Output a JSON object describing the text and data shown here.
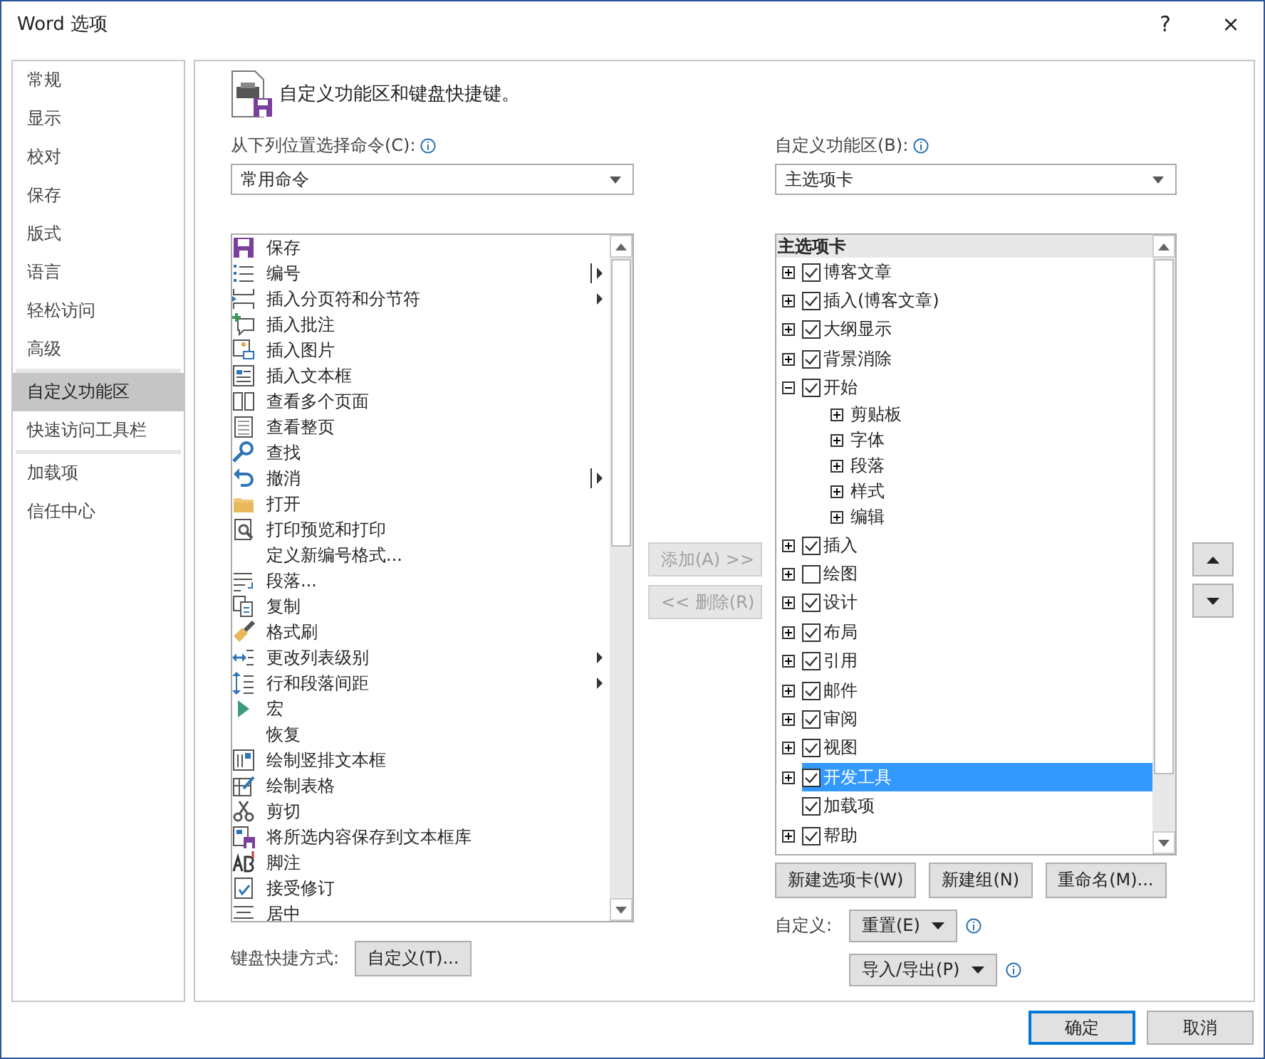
{
  "window": {
    "title": "Word 选项",
    "help": "?",
    "close": "×"
  },
  "sidebar": {
    "sections": [
      [
        {
          "label": "常规",
          "selected": false
        },
        {
          "label": "显示",
          "selected": false
        },
        {
          "label": "校对",
          "selected": false
        },
        {
          "label": "保存",
          "selected": false
        },
        {
          "label": "版式",
          "selected": false
        },
        {
          "label": "语言",
          "selected": false
        },
        {
          "label": "轻松访问",
          "selected": false
        },
        {
          "label": "高级",
          "selected": false
        }
      ],
      [
        {
          "label": "自定义功能区",
          "selected": true
        },
        {
          "label": "快速访问工具栏",
          "selected": false
        }
      ],
      [
        {
          "label": "加载项",
          "selected": false
        },
        {
          "label": "信任中心",
          "selected": false
        }
      ]
    ]
  },
  "header": {
    "title": "自定义功能区和键盘快捷键。"
  },
  "commands": {
    "label": "从下列位置选择命令(C):",
    "select": "常用命令",
    "items": [
      {
        "label": "保存",
        "has_submenu": false,
        "split": false
      },
      {
        "label": "编号",
        "has_submenu": true,
        "split": true
      },
      {
        "label": "插入分页符和分节符",
        "has_submenu": true,
        "split": false
      },
      {
        "label": "插入批注",
        "has_submenu": false,
        "split": false
      },
      {
        "label": "插入图片",
        "has_submenu": false,
        "split": false
      },
      {
        "label": "插入文本框",
        "has_submenu": false,
        "split": false
      },
      {
        "label": "查看多个页面",
        "has_submenu": false,
        "split": false
      },
      {
        "label": "查看整页",
        "has_submenu": false,
        "split": false
      },
      {
        "label": "查找",
        "has_submenu": false,
        "split": false
      },
      {
        "label": "撤消",
        "has_submenu": true,
        "split": true
      },
      {
        "label": "打开",
        "has_submenu": false,
        "split": false
      },
      {
        "label": "打印预览和打印",
        "has_submenu": false,
        "split": false
      },
      {
        "label": "定义新编号格式...",
        "has_submenu": false,
        "split": false
      },
      {
        "label": "段落...",
        "has_submenu": false,
        "split": false
      },
      {
        "label": "复制",
        "has_submenu": false,
        "split": false
      },
      {
        "label": "格式刷",
        "has_submenu": false,
        "split": false
      },
      {
        "label": "更改列表级别",
        "has_submenu": true,
        "split": false
      },
      {
        "label": "行和段落间距",
        "has_submenu": true,
        "split": false
      },
      {
        "label": "宏",
        "has_submenu": false,
        "split": false
      },
      {
        "label": "恢复",
        "has_submenu": false,
        "split": false
      },
      {
        "label": "绘制竖排文本框",
        "has_submenu": false,
        "split": false
      },
      {
        "label": "绘制表格",
        "has_submenu": false,
        "split": false
      },
      {
        "label": "剪切",
        "has_submenu": false,
        "split": false
      },
      {
        "label": "将所选内容保存到文本框库",
        "has_submenu": false,
        "split": false
      },
      {
        "label": "脚注",
        "has_submenu": false,
        "split": false
      },
      {
        "label": "接受修订",
        "has_submenu": false,
        "split": false
      },
      {
        "label": "居中",
        "has_submenu": false,
        "split": false
      }
    ],
    "keyboard_label": "键盘快捷方式:",
    "keyboard_button": "自定义(T)..."
  },
  "transfer": [
    {
      "label": "添加(A) >>",
      "disabled": true
    },
    {
      "label": "<< 删除(R)",
      "disabled": true
    }
  ],
  "ribbon": {
    "label": "自定义功能区(B):",
    "select": "主选项卡",
    "tree_header": "主选项卡",
    "tabs": [
      {
        "label": "博客文章",
        "checked": true,
        "expandable": true,
        "expanded": false,
        "selected": false
      },
      {
        "label": "插入(博客文章)",
        "checked": true,
        "expandable": true,
        "expanded": false,
        "selected": false
      },
      {
        "label": "大纲显示",
        "checked": true,
        "expandable": true,
        "expanded": false,
        "selected": false
      },
      {
        "label": "背景消除",
        "checked": true,
        "expandable": true,
        "expanded": false,
        "selected": false
      },
      {
        "label": "开始",
        "checked": true,
        "expandable": true,
        "expanded": true,
        "selected": false,
        "children": [
          {
            "label": "剪贴板",
            "expanded": false
          },
          {
            "label": "字体",
            "expanded": false
          },
          {
            "label": "段落",
            "expanded": false
          },
          {
            "label": "样式",
            "expanded": false
          },
          {
            "label": "编辑",
            "expanded": false
          }
        ]
      },
      {
        "label": "插入",
        "checked": true,
        "expandable": true,
        "expanded": false,
        "selected": false
      },
      {
        "label": "绘图",
        "checked": false,
        "expandable": true,
        "expanded": false,
        "selected": false
      },
      {
        "label": "设计",
        "checked": true,
        "expandable": true,
        "expanded": false,
        "selected": false
      },
      {
        "label": "布局",
        "checked": true,
        "expandable": true,
        "expanded": false,
        "selected": false
      },
      {
        "label": "引用",
        "checked": true,
        "expandable": true,
        "expanded": false,
        "selected": false
      },
      {
        "label": "邮件",
        "checked": true,
        "expandable": true,
        "expanded": false,
        "selected": false
      },
      {
        "label": "审阅",
        "checked": true,
        "expandable": true,
        "expanded": false,
        "selected": false
      },
      {
        "label": "视图",
        "checked": true,
        "expandable": true,
        "expanded": false,
        "selected": false
      },
      {
        "label": "开发工具",
        "checked": true,
        "expandable": true,
        "expanded": false,
        "selected": true
      },
      {
        "label": "加载项",
        "checked": true,
        "expandable": false,
        "expanded": false,
        "selected": false
      },
      {
        "label": "帮助",
        "checked": true,
        "expandable": true,
        "expanded": false,
        "selected": false
      }
    ],
    "buttons": [
      "新建选项卡(W)",
      "新建组(N)",
      "重命名(M)..."
    ],
    "customize_label": "自定义:",
    "reset_button": "重置(E)",
    "import_export_button": "导入/导出(P)"
  },
  "dialog_buttons": [
    {
      "label": "确定",
      "default": true
    },
    {
      "label": "取消",
      "default": false
    }
  ]
}
